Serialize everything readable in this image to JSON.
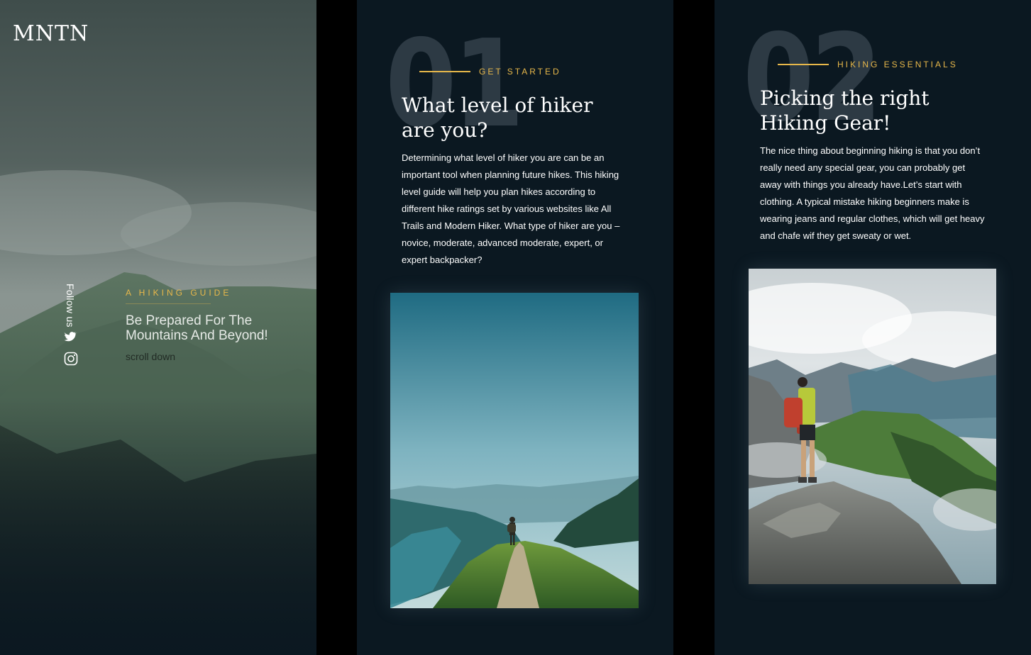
{
  "brand": {
    "logo": "MNTN"
  },
  "hero": {
    "follow_label": "Follow us",
    "social_icons": [
      "twitter-icon",
      "instagram-icon"
    ],
    "kicker": "A HIKING GUIDE",
    "title": "Be Prepared For The Mountains And Beyond!",
    "scroll_label": "scroll down"
  },
  "sections": [
    {
      "number": "01",
      "kicker": "GET STARTED",
      "title": "What level of  hiker\nare you?",
      "body": "Determining what level of hiker you are can be an important tool when planning future hikes. This hiking level guide will help you plan hikes according to different hike ratings set by various websites like All Trails and Modern Hiker. What type of hiker are you – novice, moderate, advanced moderate, expert, or expert backpacker?"
    },
    {
      "number": "02",
      "kicker": "HIKING ESSENTIALS",
      "title": "Picking the right\nHiking Gear!",
      "body": "The nice thing about beginning hiking is that you don’t really need any special gear, you can probably get away with things you already have.Let’s start with clothing. A typical mistake hiking beginners make is wearing jeans and regular clothes, which will get heavy and chafe wif they get sweaty or wet."
    }
  ],
  "colors": {
    "accent": "#e8b84a",
    "panel_bg": "#0b1821",
    "number_gray": "#2d3a44",
    "text": "#ffffff"
  }
}
